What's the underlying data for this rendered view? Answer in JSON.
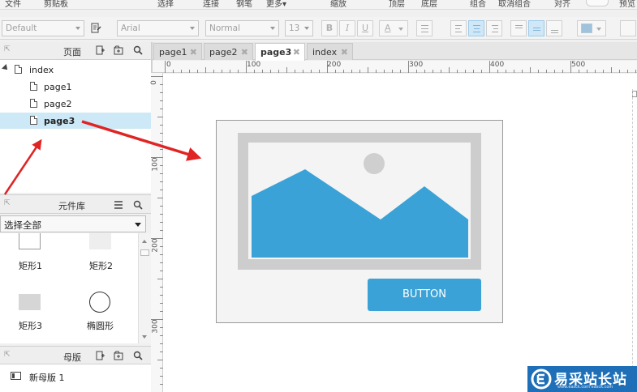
{
  "menu": {
    "items": [
      "文件",
      "剪贴板",
      "选择",
      "连接",
      "钢笔",
      "更多▾",
      "缩放",
      "顶层",
      "底层",
      "组合",
      "取消组合",
      "对齐",
      "预览"
    ]
  },
  "toolbar": {
    "style": "Default",
    "font": "Arial",
    "weight": "Normal",
    "size": "13",
    "bold": "B",
    "italic": "I",
    "underline": "U",
    "font_color": "A"
  },
  "pages_panel": {
    "title": "页面",
    "root": "index",
    "items": [
      "page1",
      "page2",
      "page3"
    ],
    "selected": "page3"
  },
  "library_panel": {
    "title": "元件库",
    "select_value": "选择全部",
    "widgets": [
      "矩形1",
      "矩形2",
      "矩形3",
      "椭圆形"
    ]
  },
  "masters_panel": {
    "title": "母版",
    "items": [
      "新母版 1"
    ]
  },
  "tabs": [
    {
      "label": "page1"
    },
    {
      "label": "page2"
    },
    {
      "label": "page3"
    },
    {
      "label": "index"
    }
  ],
  "active_tab": "page3",
  "ruler": {
    "h_labels": [
      "0",
      "100",
      "200",
      "300",
      "400",
      "500"
    ],
    "v_labels": [
      "0",
      "100",
      "200",
      "300"
    ]
  },
  "canvas": {
    "button_label": "BUTTON"
  },
  "watermark": {
    "text": "易采站长站",
    "url": "www.easck.com  easck.com"
  },
  "colors": {
    "accent": "#3aa2d6",
    "selection": "#cde8f6",
    "arrow": "#e02424",
    "watermark_bg": "#1e6fb8"
  }
}
